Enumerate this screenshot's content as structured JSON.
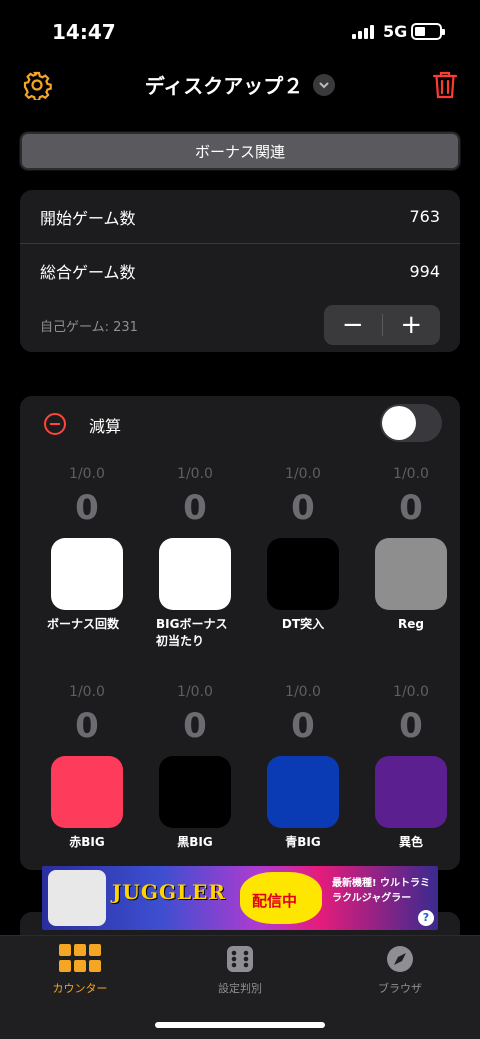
{
  "status": {
    "time": "14:47",
    "network": "5G"
  },
  "header": {
    "title": "ディスクアップ２"
  },
  "category": {
    "label": "ボーナス関連"
  },
  "games": {
    "start_label": "開始ゲーム数",
    "start_value": "763",
    "total_label": "総合ゲーム数",
    "total_value": "994",
    "self_games": "自己ゲーム: 231",
    "minus": "−",
    "plus": "+"
  },
  "panel": {
    "subtract_label": "減算",
    "row1": [
      {
        "ratio": "1/0.0",
        "count": "0",
        "label": "ボーナス回数",
        "color": "#ffffff"
      },
      {
        "ratio": "1/0.0",
        "count": "0",
        "label": "BIGボーナス初当たり",
        "color": "#ffffff"
      },
      {
        "ratio": "1/0.0",
        "count": "0",
        "label": "DT突入",
        "color": "#000000"
      },
      {
        "ratio": "1/0.0",
        "count": "0",
        "label": "Reg",
        "color": "#8e8e8e"
      }
    ],
    "row2": [
      {
        "ratio": "1/0.0",
        "count": "0",
        "label": "赤BIG",
        "color": "#ff3b5c"
      },
      {
        "ratio": "1/0.0",
        "count": "0",
        "label": "黒BIG",
        "color": "#000000"
      },
      {
        "ratio": "1/0.0",
        "count": "0",
        "label": "青BIG",
        "color": "#0a3bb5"
      },
      {
        "ratio": "1/0.0",
        "count": "0",
        "label": "異色",
        "color": "#5b1f8f"
      }
    ]
  },
  "ad": {
    "logo": "JUGGLER",
    "live": "配信中",
    "right_text": "最新機種! ウルトラミラクルジャグラー"
  },
  "tabs": [
    {
      "label": "カウンター",
      "icon": "grid-icon",
      "active": true,
      "color": "#f5a623"
    },
    {
      "label": "設定判別",
      "icon": "dice-icon",
      "active": false,
      "color": "#8e8e93"
    },
    {
      "label": "ブラウザ",
      "icon": "compass-icon",
      "active": false,
      "color": "#8e8e93"
    }
  ]
}
